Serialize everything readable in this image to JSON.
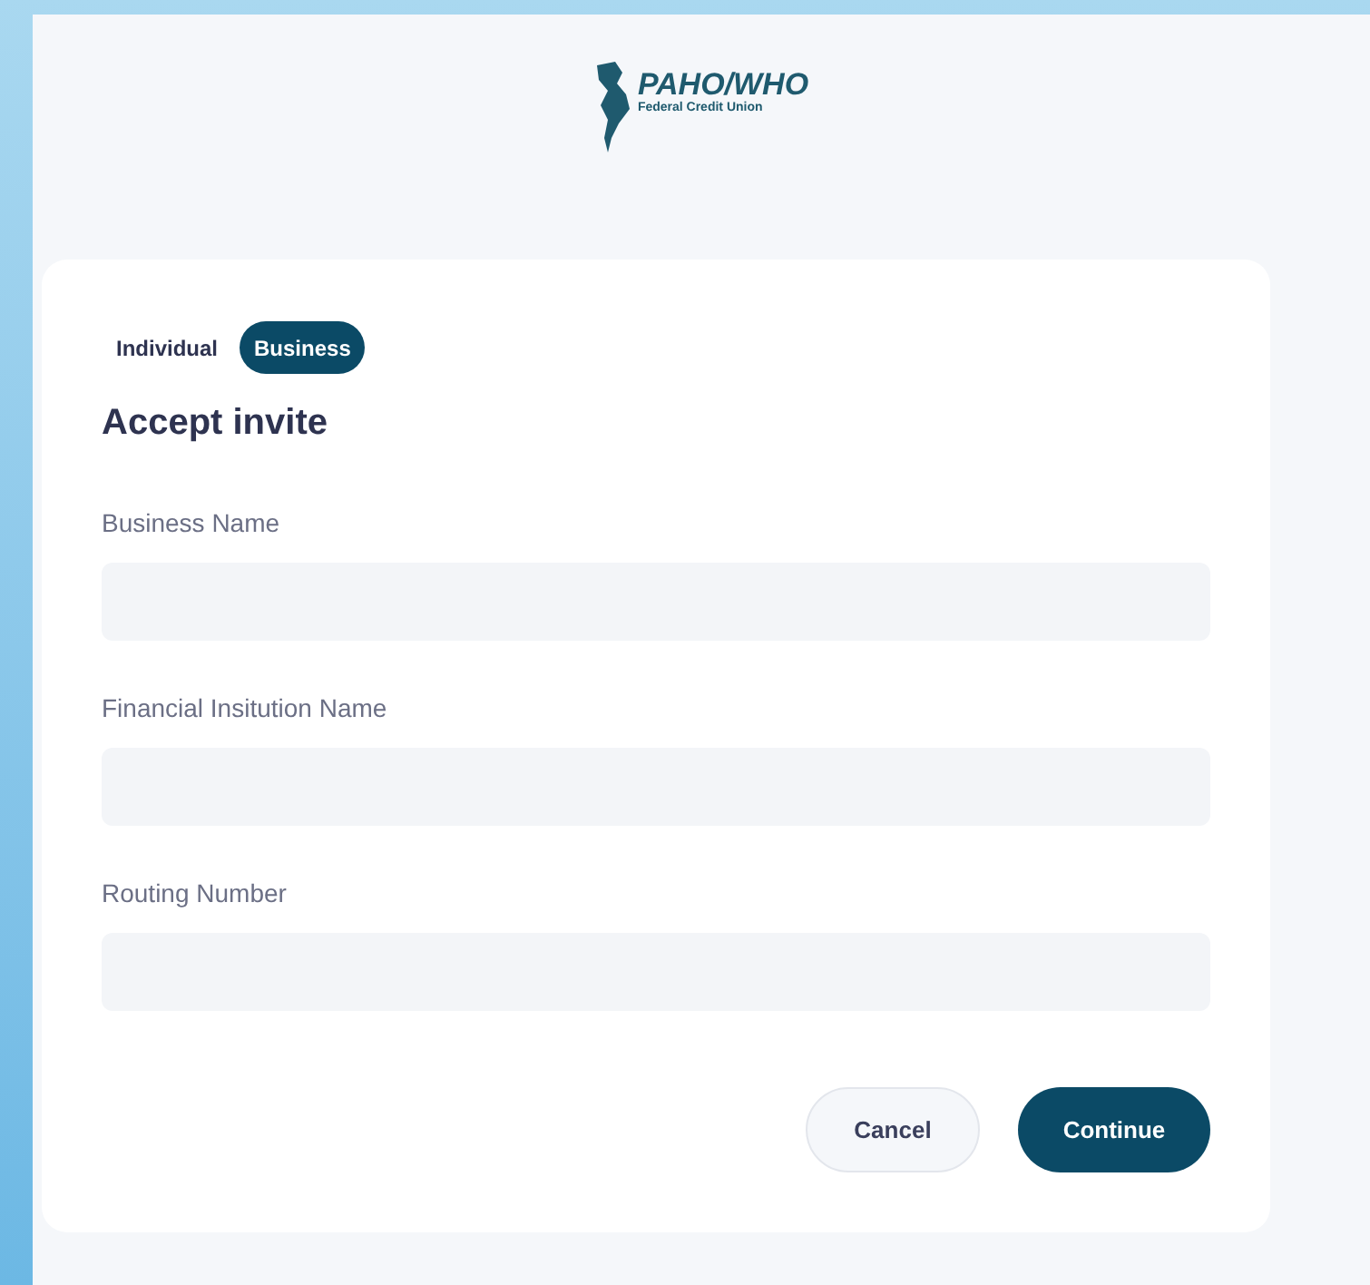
{
  "logo": {
    "name": "PAHO/WHO",
    "subtitle": "Federal Credit Union"
  },
  "tabs": [
    {
      "label": "Individual",
      "selected": false
    },
    {
      "label": "Business",
      "selected": true
    }
  ],
  "title": "Accept invite",
  "fields": [
    {
      "label": "Business Name"
    },
    {
      "label": "Financial Insitution Name"
    },
    {
      "label": "Routing Number"
    }
  ],
  "buttons": [
    {
      "label": "Cancel",
      "kind": "secondary"
    },
    {
      "label": "Continue",
      "kind": "primary"
    }
  ]
}
